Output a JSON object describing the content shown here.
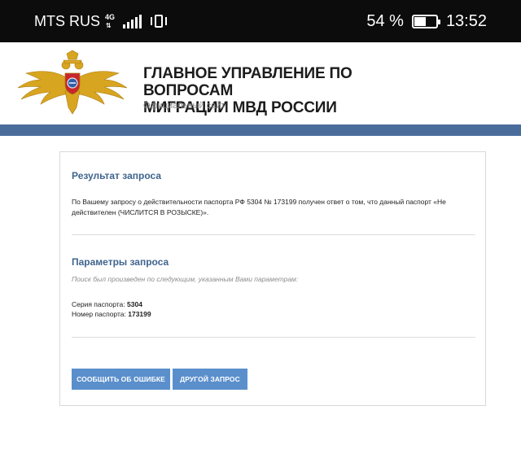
{
  "status_bar": {
    "carrier": "MTS RUS",
    "network": "4G",
    "battery_percent": "54 %",
    "battery_level": 0.54,
    "time": "13:52"
  },
  "header": {
    "title_line1": "ГЛАВНОЕ УПРАВЛЕНИЕ ПО ВОПРОСАМ",
    "title_line2": "МИГРАЦИИ МВД РОССИИ",
    "subtitle": "Официальный сайт"
  },
  "result": {
    "title": "Результат запроса",
    "text": "По Вашему запросу о действительности паспорта РФ 5304 № 173199 получен ответ о том, что данный паспорт «Не действителен (ЧИСЛИТСЯ В РОЗЫСКЕ)»."
  },
  "params": {
    "title": "Параметры запроса",
    "note": "Поиск был произведен по следующим, указанным Вами параметрам:",
    "series_label": "Серия паспорта:",
    "series_value": "5304",
    "number_label": "Номер паспорта:",
    "number_value": "173199"
  },
  "buttons": {
    "report_error": "СООБЩИТЬ ОБ ОШИБКЕ",
    "another_request": "ДРУГОЙ ЗАПРОС"
  },
  "colors": {
    "accent_blue": "#4a6c9b",
    "button_blue": "#5a8fcc",
    "section_title": "#3f648e",
    "emblem_gold": "#d8a520"
  }
}
